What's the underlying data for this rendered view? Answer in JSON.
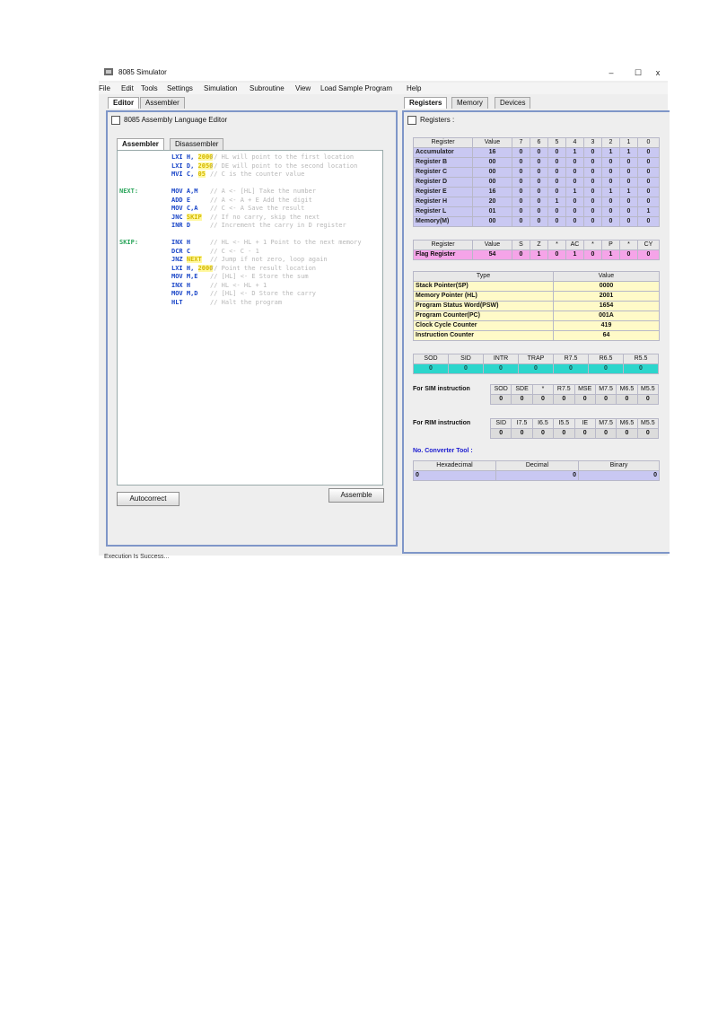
{
  "window": {
    "title": "8085 Simulator",
    "minimize": "–",
    "maximize": "☐",
    "close": "x"
  },
  "menu": [
    "File",
    "Edit",
    "Tools",
    "Settings",
    "Simulation",
    "Subroutine",
    "View",
    "Load Sample Program",
    "Help"
  ],
  "left_tabs": [
    "Editor",
    "Assembler"
  ],
  "right_tabs": [
    "Registers",
    "Memory",
    "Devices"
  ],
  "editor_panel": {
    "title": "8085 Assembly Language Editor",
    "sub_tabs": [
      "Assembler",
      "Disassembler"
    ],
    "code": [
      {
        "label": "",
        "instr": "LXI H,",
        "operand": "2000",
        "comment": "// HL will point to the first location"
      },
      {
        "label": "",
        "instr": "LXI D,",
        "operand": "2050",
        "comment": "// DE will point to the second location"
      },
      {
        "label": "",
        "instr": "MVI C,",
        "operand": "05",
        "comment": "// C is the counter value"
      },
      {
        "label": "",
        "instr": "",
        "operand": "",
        "comment": ""
      },
      {
        "label": "NEXT:",
        "instr": "MOV A,M",
        "operand": "",
        "comment": "// A <- [HL]  Take the number"
      },
      {
        "label": "",
        "instr": "ADD E",
        "operand": "",
        "comment": "// A <- A + E  Add the digit"
      },
      {
        "label": "",
        "instr": "MOV C,A",
        "operand": "",
        "comment": "// C <- A  Save the result"
      },
      {
        "label": "",
        "instr": "JNC",
        "operand": "SKIP",
        "comment": "// If no carry, skip the next"
      },
      {
        "label": "",
        "instr": "INR D",
        "operand": "",
        "comment": "// Increment the carry in D register"
      },
      {
        "label": "",
        "instr": "",
        "operand": "",
        "comment": ""
      },
      {
        "label": "SKIP:",
        "instr": "INX H",
        "operand": "",
        "comment": "// HL <- HL + 1  Point to the next memory"
      },
      {
        "label": "",
        "instr": "DCR C",
        "operand": "",
        "comment": "// C <- C - 1"
      },
      {
        "label": "",
        "instr": "JNZ",
        "operand": "NEXT",
        "comment": "// Jump if not zero, loop again"
      },
      {
        "label": "",
        "instr": "LXI H,",
        "operand": "2000",
        "comment": "// Point the result location"
      },
      {
        "label": "",
        "instr": "MOV M,E",
        "operand": "",
        "comment": "// [HL] <- E  Store the sum"
      },
      {
        "label": "",
        "instr": "INX H",
        "operand": "",
        "comment": "// HL <- HL + 1"
      },
      {
        "label": "",
        "instr": "MOV M,D",
        "operand": "",
        "comment": "// [HL] <- D  Store the carry"
      },
      {
        "label": "",
        "instr": "HLT",
        "operand": "",
        "comment": "// Halt the program"
      }
    ],
    "autocorrect_label": "Autocorrect",
    "assemble_label": "Assemble"
  },
  "registers_panel": {
    "title": "Registers :",
    "reg_headers": [
      "Register",
      "Value",
      "7",
      "6",
      "5",
      "4",
      "3",
      "2",
      "1",
      "0"
    ],
    "registers": [
      {
        "name": "Accumulator",
        "value": "16",
        "bits": [
          "0",
          "0",
          "0",
          "1",
          "0",
          "1",
          "1",
          "0"
        ]
      },
      {
        "name": "Register B",
        "value": "00",
        "bits": [
          "0",
          "0",
          "0",
          "0",
          "0",
          "0",
          "0",
          "0"
        ]
      },
      {
        "name": "Register C",
        "value": "00",
        "bits": [
          "0",
          "0",
          "0",
          "0",
          "0",
          "0",
          "0",
          "0"
        ]
      },
      {
        "name": "Register D",
        "value": "00",
        "bits": [
          "0",
          "0",
          "0",
          "0",
          "0",
          "0",
          "0",
          "0"
        ]
      },
      {
        "name": "Register E",
        "value": "16",
        "bits": [
          "0",
          "0",
          "0",
          "1",
          "0",
          "1",
          "1",
          "0"
        ]
      },
      {
        "name": "Register H",
        "value": "20",
        "bits": [
          "0",
          "0",
          "1",
          "0",
          "0",
          "0",
          "0",
          "0"
        ]
      },
      {
        "name": "Register L",
        "value": "01",
        "bits": [
          "0",
          "0",
          "0",
          "0",
          "0",
          "0",
          "0",
          "1"
        ]
      },
      {
        "name": "Memory(M)",
        "value": "00",
        "bits": [
          "0",
          "0",
          "0",
          "0",
          "0",
          "0",
          "0",
          "0"
        ]
      }
    ],
    "flag_headers": [
      "Register",
      "Value",
      "S",
      "Z",
      "*",
      "AC",
      "*",
      "P",
      "*",
      "CY"
    ],
    "flag": {
      "name": "Flag Register",
      "value": "54",
      "bits": [
        "0",
        "1",
        "0",
        "1",
        "0",
        "1",
        "0",
        "0"
      ]
    },
    "special_headers": [
      "Type",
      "Value"
    ],
    "special": [
      {
        "type": "Stack Pointer(SP)",
        "value": "0000"
      },
      {
        "type": "Memory Pointer (HL)",
        "value": "2001"
      },
      {
        "type": "Program Status Word(PSW)",
        "value": "1654"
      },
      {
        "type": "Program Counter(PC)",
        "value": "001A"
      },
      {
        "type": "Clock Cycle Counter",
        "value": "419"
      },
      {
        "type": "Instruction Counter",
        "value": "64"
      }
    ],
    "intr_headers": [
      "SOD",
      "SID",
      "INTR",
      "TRAP",
      "R7.5",
      "R6.5",
      "R5.5"
    ],
    "intr_values": [
      "0",
      "0",
      "0",
      "0",
      "0",
      "0",
      "0"
    ],
    "sim_label": "For SIM instruction",
    "sim_headers": [
      "SOD",
      "SDE",
      "*",
      "R7.5",
      "MSE",
      "M7.5",
      "M6.5",
      "M5.5"
    ],
    "sim_values": [
      "0",
      "0",
      "0",
      "0",
      "0",
      "0",
      "0",
      "0"
    ],
    "rim_label": "For RIM instruction",
    "rim_headers": [
      "SID",
      "I7.5",
      "I6.5",
      "I5.5",
      "IE",
      "M7.5",
      "M6.5",
      "M5.5"
    ],
    "rim_values": [
      "0",
      "0",
      "0",
      "0",
      "0",
      "0",
      "0",
      "0"
    ],
    "converter_label": "No. Converter Tool :",
    "conv_headers": [
      "Hexadecimal",
      "Decimal",
      "Binary"
    ],
    "conv_values": [
      "0",
      "0",
      "0"
    ]
  },
  "status_text": "Execution Is Success..."
}
